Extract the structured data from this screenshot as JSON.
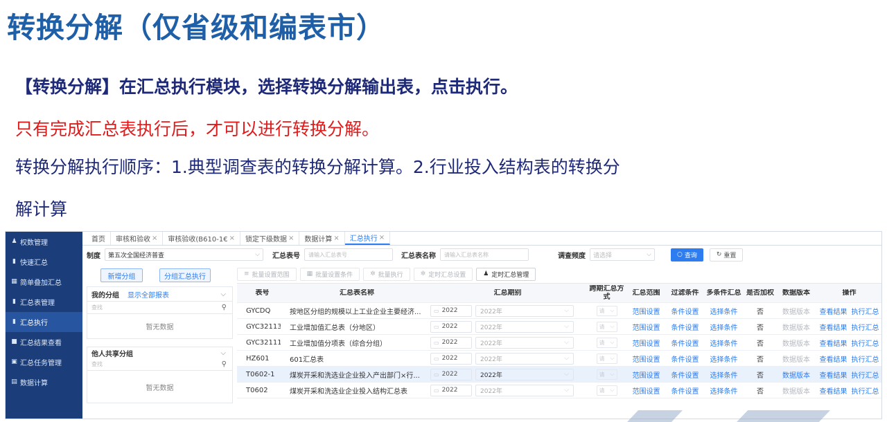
{
  "slide": {
    "title": "转换分解（仅省级和编表市）",
    "line1": "【转换分解】在汇总执行模块，选择转换分解输出表，点击执行。",
    "line2": "只有完成汇总表执行后，才可以进行转换分解。",
    "line3": "转换分解执行顺序：1.典型调查表的转换分解计算。2.行业投入结构表的转换分",
    "line4": "解计算"
  },
  "sidebar": {
    "items": [
      {
        "label": "权数管理",
        "icon": "user-icon"
      },
      {
        "label": "快速汇总",
        "icon": "bar-chart-icon"
      },
      {
        "label": "简单叠加汇总",
        "icon": "table-icon"
      },
      {
        "label": "汇总表管理",
        "icon": "bar-chart-icon"
      },
      {
        "label": "汇总执行",
        "icon": "bar-chart-icon"
      },
      {
        "label": "汇总结果查看",
        "icon": "screen-icon"
      },
      {
        "label": "汇总任务管理",
        "icon": "tasks-icon"
      },
      {
        "label": "数据计算",
        "icon": "calculator-icon"
      }
    ]
  },
  "tabs": [
    {
      "label": "首页",
      "closable": false
    },
    {
      "label": "审核和验收",
      "closable": true
    },
    {
      "label": "审核验收(B610-1€",
      "closable": true
    },
    {
      "label": "锁定下级数据",
      "closable": true
    },
    {
      "label": "数据计算",
      "closable": true
    },
    {
      "label": "汇总执行",
      "closable": true,
      "active": true
    }
  ],
  "filters": {
    "system_label": "制度",
    "system_value": "第五次全国经济普查",
    "code_label": "汇总表号",
    "code_placeholder": "请输入汇总表号",
    "name_label": "汇总表名称",
    "name_placeholder": "请输入汇总表名称",
    "freq_label": "调查频度",
    "freq_placeholder": "请选择",
    "search_button": "查询",
    "reset_button": "重置"
  },
  "left_panel": {
    "add_group_button": "新增分组",
    "group_exec_button": "分组汇总执行",
    "my_group_label": "我的分组",
    "show_all_link": "显示全部报表",
    "search_placeholder": "查找",
    "empty_text": "暂无数据",
    "shared_group_label": "他人共享分组",
    "search_placeholder2": "查找",
    "empty_text2": "暂无数据"
  },
  "toolbar": {
    "batch_scope": "批量设置范围",
    "batch_condition": "批量设置条件",
    "batch_exec": "批量执行",
    "timed_setting": "定时汇总设置",
    "timed_manage": "定时汇总管理"
  },
  "table": {
    "headers": {
      "code": "表号",
      "name": "汇总表名称",
      "period": "汇总期别",
      "span": "跨期汇总方式",
      "scope": "汇总范围",
      "filter": "过滤条件",
      "multi": "多条件汇总",
      "weighted": "是否加权",
      "version": "数据版本",
      "ops": "操作"
    },
    "rows": [
      {
        "code": "GYCDQ",
        "name": "按地区分组的规模以上工业企业主要经济...",
        "year": "2022",
        "period": "2022年",
        "span": "请",
        "scope": "范围设置",
        "filter": "条件设置",
        "multi": "选择条件",
        "weighted": "否",
        "version": "数据版本",
        "view": "查看结果",
        "exec": "执行汇总",
        "selected": false,
        "period_dark": false
      },
      {
        "code": "GYC32113",
        "name": "工业增加值汇总表（分地区）",
        "year": "2022",
        "period": "2022年",
        "span": "请",
        "scope": "范围设置",
        "filter": "条件设置",
        "multi": "选择条件",
        "weighted": "否",
        "version": "数据版本",
        "view": "查看结果",
        "exec": "执行汇总",
        "selected": false,
        "period_dark": false
      },
      {
        "code": "GYC32111",
        "name": "工业增加值分项表（综合分组）",
        "year": "2022",
        "period": "2022年",
        "span": "请",
        "scope": "范围设置",
        "filter": "条件设置",
        "multi": "选择条件",
        "weighted": "否",
        "version": "数据版本",
        "view": "查看结果",
        "exec": "执行汇总",
        "selected": false,
        "period_dark": false
      },
      {
        "code": "HZ601",
        "name": "601汇总表",
        "year": "2022",
        "period": "2022年",
        "span": "请",
        "scope": "范围设置",
        "filter": "条件设置",
        "multi": "选择条件",
        "weighted": "否",
        "version": "数据版本",
        "view": "查看结果",
        "exec": "执行汇总",
        "selected": false,
        "period_dark": false
      },
      {
        "code": "T0602-1",
        "name": "煤炭开采和洗选业企业投入产出部门×行...",
        "year": "2022",
        "period": "2022年",
        "span": "请",
        "scope": "范围设置",
        "filter": "条件设置",
        "multi": "选择条件",
        "weighted": "否",
        "version": "数据版本",
        "view": "查看结果",
        "exec": "执行汇总",
        "selected": true,
        "period_dark": true
      },
      {
        "code": "T0602",
        "name": "煤炭开采和洗选业企业投入结构汇总表",
        "year": "2022",
        "period": "2022年",
        "span": "请",
        "scope": "范围设置",
        "filter": "条件设置",
        "multi": "选择条件",
        "weighted": "否",
        "version": "数据版本",
        "view": "查看结果",
        "exec": "执行汇总",
        "selected": false,
        "period_dark": false
      }
    ]
  },
  "colors": {
    "title": "#1f5fa8",
    "body_text": "#1e2a78",
    "warning": "#e01b1b",
    "sidebar": "#1b3e7a",
    "accent": "#2d7cf0"
  }
}
